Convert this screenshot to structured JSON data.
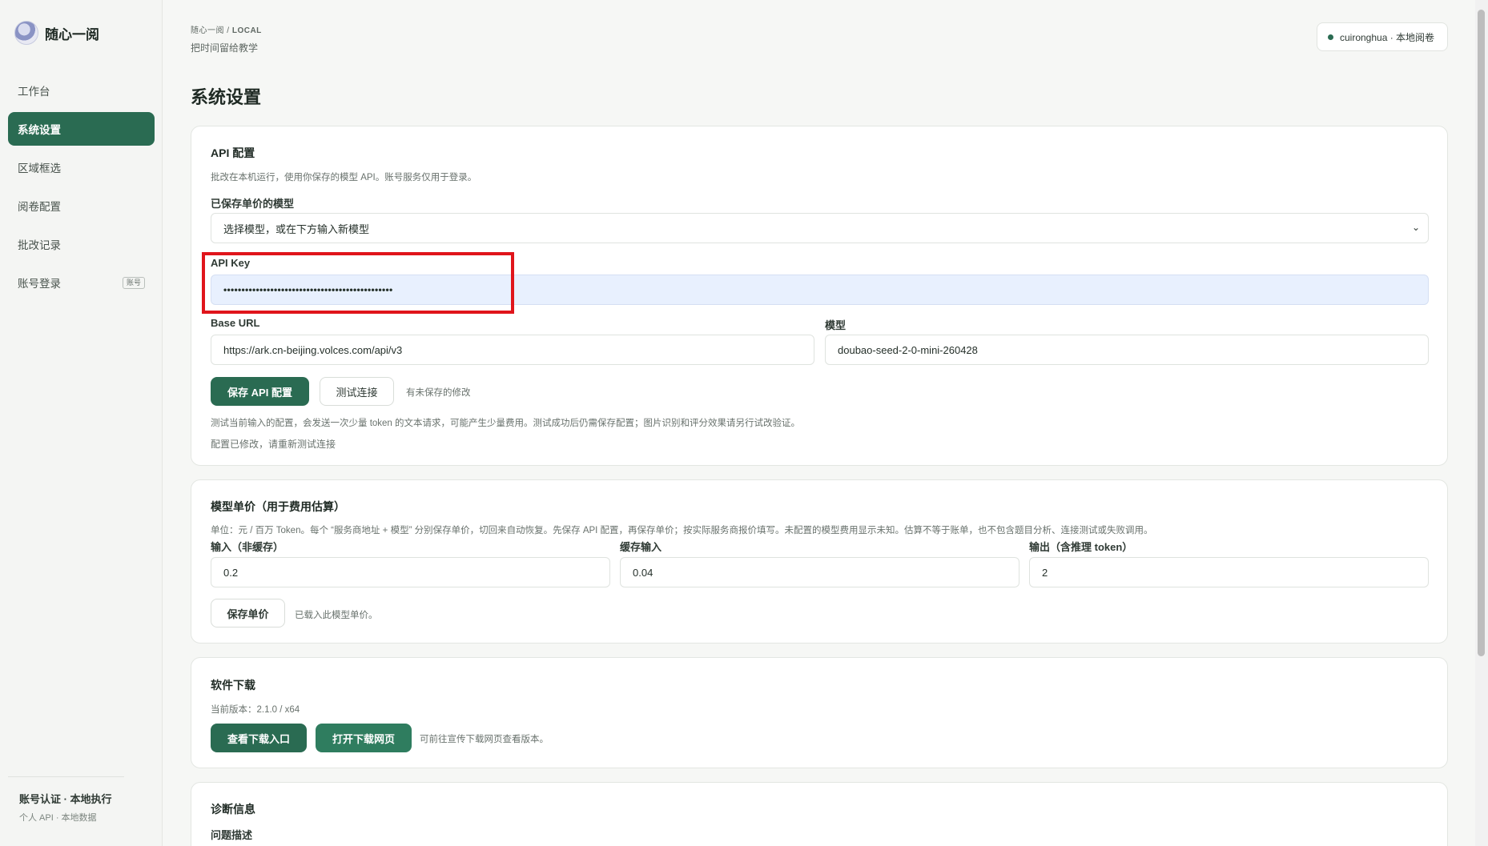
{
  "brand": {
    "name": "随心一阅"
  },
  "sidebar": {
    "items": [
      {
        "label": "工作台",
        "active": false
      },
      {
        "label": "系统设置",
        "active": true
      },
      {
        "label": "区域框选",
        "active": false
      },
      {
        "label": "阅卷配置",
        "active": false
      },
      {
        "label": "批改记录",
        "active": false
      },
      {
        "label": "账号登录",
        "active": false,
        "badge": "账号"
      }
    ],
    "footer": {
      "title": "账号认证 · 本地执行",
      "subtitle": "个人 API · 本地数据"
    }
  },
  "header": {
    "breadcrumb_root": "随心一阅",
    "breadcrumb_sep": "/",
    "breadcrumb_current": "LOCAL",
    "tagline": "把时间留给教学",
    "user_chip": "cuironghua · 本地阅卷"
  },
  "page": {
    "title": "系统设置"
  },
  "api_card": {
    "title": "API 配置",
    "desc": "批改在本机运行，使用你保存的模型 API。账号服务仅用于登录。",
    "saved_model_label": "已保存单价的模型",
    "saved_model_value": "选择模型，或在下方输入新模型",
    "api_key_label": "API Key",
    "api_key_value": "•••••••••••••••••••••••••••••••••••••••••••••••",
    "base_url_label": "Base URL",
    "base_url_value": "https://ark.cn-beijing.volces.com/api/v3",
    "model_label": "模型",
    "model_value": "doubao-seed-2-0-mini-260428",
    "save_button": "保存 API 配置",
    "test_button": "测试连接",
    "unsaved_note": "有未保存的修改",
    "test_note": "测试当前输入的配置，会发送一次少量 token 的文本请求，可能产生少量费用。测试成功后仍需保存配置；图片识别和评分效果请另行试改验证。",
    "status_note": "配置已修改，请重新测试连接"
  },
  "price_card": {
    "title": "模型单价（用于费用估算）",
    "desc": "单位：元 / 百万 Token。每个 “服务商地址 + 模型” 分别保存单价，切回来自动恢复。先保存 API 配置，再保存单价；按实际服务商报价填写。未配置的模型费用显示未知。估算不等于账单，也不包含题目分析、连接测试或失败调用。",
    "input_label": "输入（非缓存）",
    "input_value": "0.2",
    "cached_label": "缓存输入",
    "cached_value": "0.04",
    "output_label": "输出（含推理 token）",
    "output_value": "2",
    "save_button": "保存单价",
    "loaded_note": "已载入此模型单价。"
  },
  "download_card": {
    "title": "软件下载",
    "version": "当前版本：2.1.0 / x64",
    "view_button": "查看下载入口",
    "open_button": "打开下载网页",
    "note": "可前往宣传下载网页查看版本。"
  },
  "diag_card": {
    "title": "诊断信息",
    "problem_label": "问题描述"
  },
  "colors": {
    "accent": "#2a6b52",
    "highlight": "#e0151b",
    "key_bg": "#e8f0fe"
  }
}
